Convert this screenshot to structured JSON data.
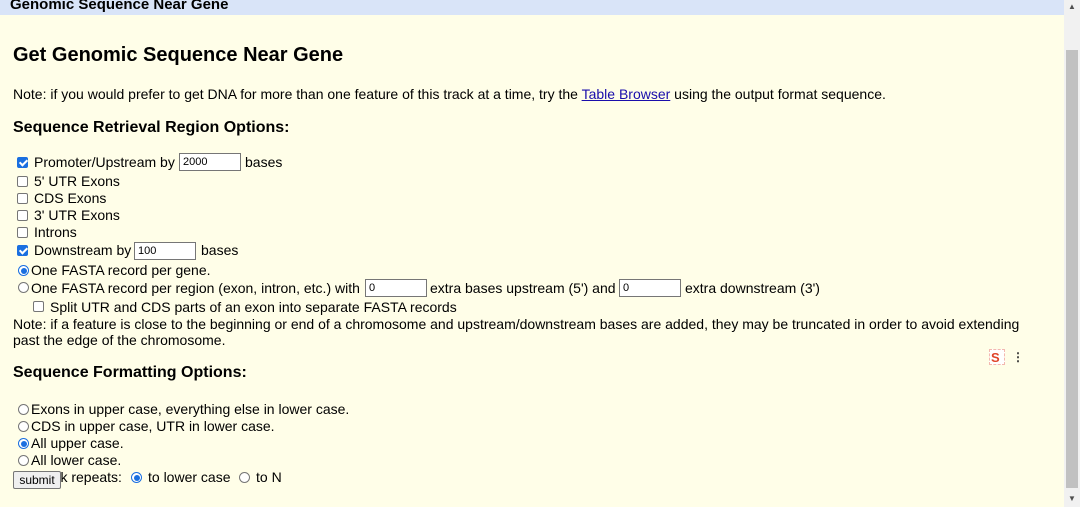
{
  "header": {
    "title": "Genomic Sequence Near Gene"
  },
  "page": {
    "heading": "Get Genomic Sequence Near Gene",
    "note1_before": "Note: if you would prefer to get DNA for more than one feature of this track at a time, try the ",
    "note1_link": "Table Browser",
    "note1_after": " using the output format sequence."
  },
  "region": {
    "heading": "Sequence Retrieval Region Options:",
    "promoter_label": "Promoter/Upstream by",
    "promoter_value": "2000",
    "bases_label": "bases",
    "utr5_label": "5' UTR Exons",
    "cds_label": "CDS Exons",
    "utr3_label": "3' UTR Exons",
    "introns_label": "Introns",
    "downstream_label": "Downstream by",
    "downstream_value": "100",
    "one_per_gene_label": "One FASTA record per gene.",
    "one_per_region_label": "One FASTA record per region (exon, intron, etc.) with",
    "extra_up_value": "0",
    "extra_up_label": "extra bases upstream (5') and",
    "extra_down_value": "0",
    "extra_down_label": "extra downstream (3')",
    "split_label": "Split UTR and CDS parts of an exon into separate FASTA records",
    "note2_line1": "Note: if a feature is close to the beginning or end of a chromosome and upstream/downstream bases are added, they may be truncated in order to avoid extending",
    "note2_line2": "past the edge of the chromosome."
  },
  "format": {
    "heading": "Sequence Formatting Options:",
    "exons_upper_label": "Exons in upper case, everything else in lower case.",
    "cds_upper_label": "CDS in upper case, UTR in lower case.",
    "all_upper_label": "All upper case.",
    "all_lower_label": "All lower case.",
    "mask_label": "Mask repeats:",
    "to_lower_label": "to lower case",
    "to_n_label": "to N"
  },
  "extension": {
    "icon_glyph": "S",
    "menu_glyph": "⋮"
  },
  "submit_label": "submit",
  "state": {
    "promoter_checked": true,
    "utr5_checked": false,
    "cds_checked": false,
    "utr3_checked": false,
    "introns_checked": false,
    "downstream_checked": true,
    "fasta_mode": "one_per_gene",
    "split_checked": false,
    "case_mode": "all_upper",
    "mask_checked": false,
    "mask_mode": "to_lower"
  },
  "colors": {
    "background": "#fffee8",
    "titlebar": "#d9e4f8",
    "link": "#1a0dab",
    "accent": "#1a6fe0"
  }
}
